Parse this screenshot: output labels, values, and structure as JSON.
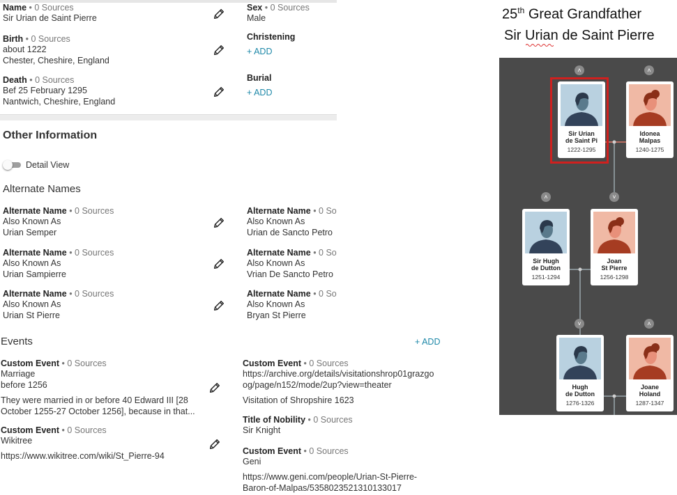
{
  "vitals": {
    "name": {
      "label": "Name",
      "sources": "• 0 Sources",
      "value": "Sir Urian de Saint Pierre"
    },
    "sex": {
      "label": "Sex",
      "sources": "• 0 Sources",
      "value": "Male"
    },
    "birth": {
      "label": "Birth",
      "sources": "• 0 Sources",
      "line1": "about 1222",
      "line2": "Chester, Cheshire, England"
    },
    "christening": {
      "label": "Christening",
      "add": "+  ADD"
    },
    "death": {
      "label": "Death",
      "sources": "• 0 Sources",
      "line1": "Bef 25 February 1295",
      "line2": "Nantwich, Cheshire, England"
    },
    "burial": {
      "label": "Burial",
      "add": "+  ADD"
    }
  },
  "other_info": {
    "title": "Other Information",
    "detail_view": "Detail View"
  },
  "alternate_names": {
    "title": "Alternate Names",
    "left": [
      {
        "label": "Alternate Name",
        "sources": "• 0 Sources",
        "type": "Also Known As",
        "value": "Urian Semper"
      },
      {
        "label": "Alternate Name",
        "sources": "• 0 Sources",
        "type": "Also Known As",
        "value": "Urian Sampierre"
      },
      {
        "label": "Alternate Name",
        "sources": "• 0 Sources",
        "type": "Also Known As",
        "value": "Urian St Pierre"
      }
    ],
    "right": [
      {
        "label": "Alternate Name",
        "sources": "• 0 So",
        "type": "Also Known As",
        "value": "Urian de Sancto Petro"
      },
      {
        "label": "Alternate Name",
        "sources": "• 0 So",
        "type": "Also Known As",
        "value": "Vrian De Sancto Petro"
      },
      {
        "label": "Alternate Name",
        "sources": "• 0 So",
        "type": "Also Known As",
        "value": "Bryan St Pierre"
      }
    ]
  },
  "events": {
    "title": "Events",
    "add": "+  ADD",
    "left": [
      {
        "label": "Custom Event",
        "sources": "• 0 Sources",
        "line1": "Marriage",
        "line2": "before 1256",
        "desc1": "They were married in or before 40 Edward III [28",
        "desc2": "October 1255-27 October 1256], because in that..."
      },
      {
        "label": "Custom Event",
        "sources": "• 0 Sources",
        "line1": "Wikitree",
        "desc1": "https://www.wikitree.com/wiki/St_Pierre-94"
      }
    ],
    "right": [
      {
        "label": "Custom Event",
        "sources": "• 0 Sources",
        "line1": "https://archive.org/details/visitationshrop01grazgo",
        "line2": "og/page/n152/mode/2up?view=theater",
        "desc1": "Visitation of Shropshire 1623"
      },
      {
        "label": "Title of Nobility",
        "sources": "• 0 Sources",
        "line1": "Sir Knight"
      },
      {
        "label": "Custom Event",
        "sources": "• 0 Sources",
        "line1": "Geni",
        "desc1": "https://www.geni.com/people/Urian-St-Pierre-",
        "desc2": "Baron-of-Malpas/5358023521310133017"
      }
    ]
  },
  "header": {
    "ordinal": "25",
    "sup": "th",
    "rest": " Great Grandfather",
    "name": "Sir Urian de Saint Pierre"
  },
  "tree": {
    "colors": {
      "male_bg": "#b9d1e0",
      "female_bg": "#f0b9a5",
      "male_fig": "#33435a",
      "female_fig": "#a63c22",
      "selected": "#d0201e",
      "line": "#9aa8ad",
      "spouse_line": "#e07a6a"
    },
    "people": [
      {
        "name": "Sir Urian\nde Saint Pi",
        "years": "1222-1295",
        "gender": "male",
        "selected": true
      },
      {
        "name": "Idonea\nMalpas",
        "years": "1240-1275",
        "gender": "female"
      },
      {
        "name": "Sir Hugh\nde Dutton",
        "years": "1251-1294",
        "gender": "male"
      },
      {
        "name": "Joan\nSt Pierre",
        "years": "1256-1298",
        "gender": "female"
      },
      {
        "name": "Hugh\nde Dutton",
        "years": "1276-1326",
        "gender": "male"
      },
      {
        "name": "Joane\nHoland",
        "years": "1287-1347",
        "gender": "female"
      }
    ]
  }
}
